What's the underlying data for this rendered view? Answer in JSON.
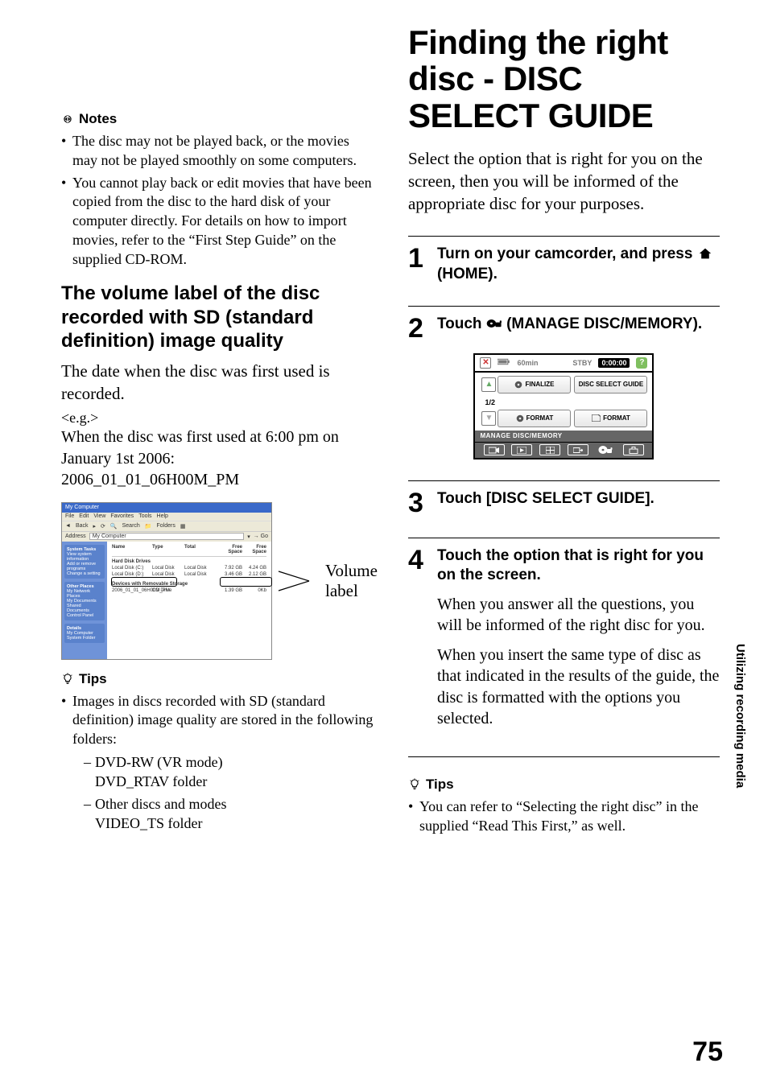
{
  "main_title": "Finding the right disc - DISC SELECT GUIDE",
  "intro_text": "Select the option that is right for you on the screen, then you will be informed of the appropriate disc for your purposes.",
  "left": {
    "notes_heading": "Notes",
    "notes_items": [
      "The disc may not be played back, or the movies may not be played smoothly on some computers.",
      "You cannot play back or edit movies that have been copied from the disc to the hard disk of your computer directly. For details on how to import movies, refer to the “First Step Guide” on the supplied CD-ROM."
    ],
    "subheading": "The volume label of the disc recorded with SD (standard definition) image quality",
    "sub_body": "The date when the disc was first used is recorded.",
    "eg_label": "<e.g.>",
    "eg_line1": "When the disc was first used at 6:00 pm on January 1st 2006:",
    "eg_line2": "2006_01_01_06H00M_PM",
    "screenshot": {
      "title": "My Computer",
      "menu": [
        "File",
        "Edit",
        "View",
        "Favorites",
        "Tools",
        "Help"
      ],
      "toolbar": [
        "Back",
        "",
        "Search",
        "Folders"
      ],
      "address_label": "Address",
      "address_value": "My Computer",
      "side_panels": [
        {
          "title": "System Tasks",
          "items": [
            "View system information",
            "Add or remove programs",
            "Change a setting"
          ]
        },
        {
          "title": "Other Places",
          "items": [
            "My Network Places",
            "My Documents",
            "Shared Documents",
            "Control Panel"
          ]
        },
        {
          "title": "Details",
          "items": [
            "My Computer",
            "System Folder"
          ]
        }
      ],
      "headers": [
        "Name",
        "Type",
        "Total",
        "Free Space",
        "Free Space"
      ],
      "groups": [
        {
          "label": "Hard Disk Drives",
          "rows": [
            {
              "name": "Local Disk (C:)",
              "type": "Local Disk",
              "total": "Local Disk",
              "size": "7.92 GB",
              "free": "4.24 GB"
            },
            {
              "name": "Local Disk (D:)",
              "type": "Local Disk",
              "total": "Local Disk",
              "size": "3.46 GB",
              "free": "2.12 GB"
            }
          ]
        },
        {
          "label": "Devices with Removable Storage",
          "rows": [
            {
              "name": "2006_01_01_06H00M_PM",
              "type": "CD Drive",
              "total": "",
              "size": "1.39 GB",
              "free": "0Kb"
            }
          ]
        }
      ],
      "callout_label": "Volume label"
    },
    "tips_heading": "Tips",
    "tips_intro": "Images in discs recorded with SD (standard definition) image quality are stored in the following folders:",
    "tips_sub": [
      "DVD-RW (VR mode)\nDVD_RTAV folder",
      "Other discs and modes\nVIDEO_TS folder"
    ]
  },
  "steps": [
    {
      "num": "1",
      "text_before": "Turn on your camcorder, and press ",
      "text_after": " (HOME).",
      "icon": "home"
    },
    {
      "num": "2",
      "text_before": "Touch ",
      "text_after": " (MANAGE DISC/MEMORY).",
      "icon": "manage"
    },
    {
      "num": "3",
      "text": "Touch [DISC SELECT GUIDE]."
    },
    {
      "num": "4",
      "text": "Touch the option that is right for you on the screen.",
      "body": [
        "When you answer all the questions, you will be informed of the right disc for you.",
        "When you insert the same type of disc as that indicated in the results of the guide, the disc is formatted with the options you selected."
      ]
    }
  ],
  "camcorder": {
    "battery_label": "60min",
    "stby": "STBY",
    "time": "0:00:00",
    "paging": "1/2",
    "buttons": [
      "FINALIZE",
      "DISC SELECT GUIDE",
      "FORMAT",
      "FORMAT"
    ],
    "label_row": "MANAGE DISC/MEMORY"
  },
  "right_tips_heading": "Tips",
  "right_tips_item": "You can refer to “Selecting the right disc” in the supplied “Read This First,” as well.",
  "sidebar": "Utilizing recording media",
  "page_num": "75"
}
